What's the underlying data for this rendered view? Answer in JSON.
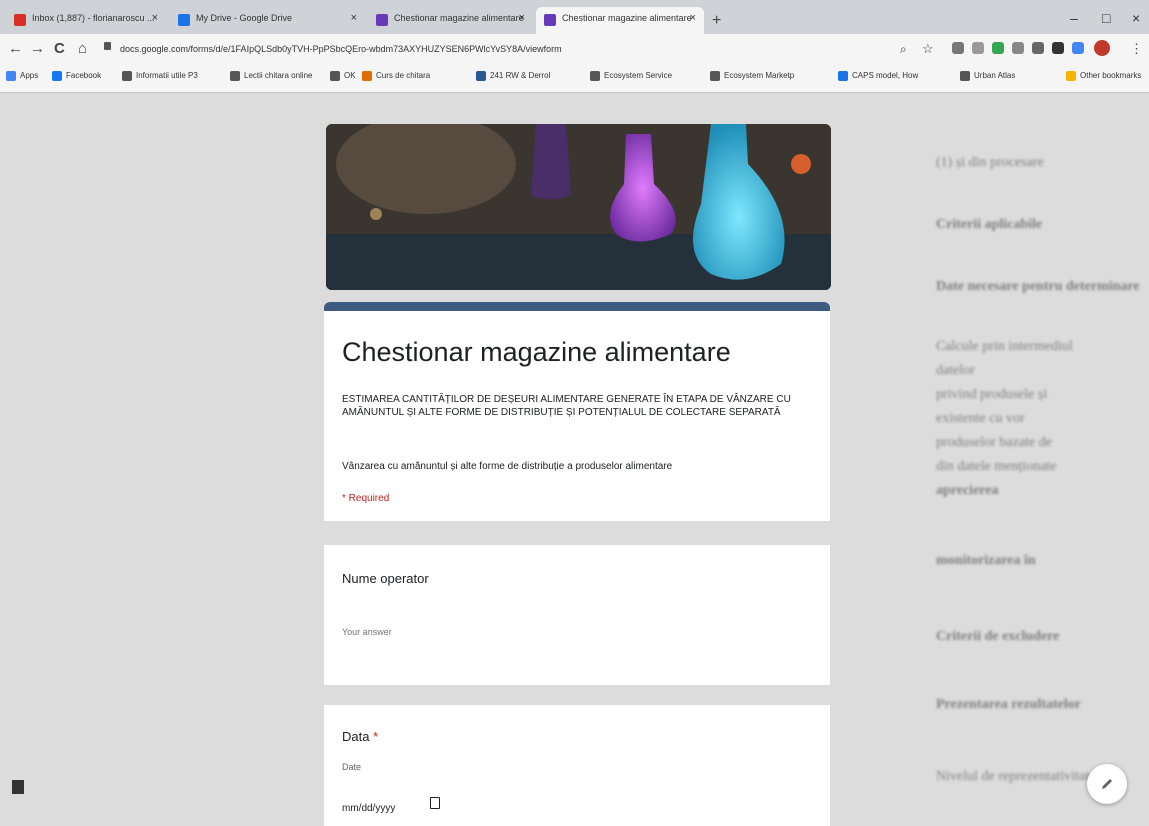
{
  "browser": {
    "tabs": [
      {
        "label": "Inbox (1,887) - florianaroscu ...",
        "color": "#d93025"
      },
      {
        "label": "My Drive - Google Drive",
        "color": "#1a73e8"
      },
      {
        "label": "Chestionar magazine alimentare",
        "color": "#673ab7"
      },
      {
        "label": "Chestionar magazine alimentare",
        "color": "#673ab7"
      }
    ],
    "url": "docs.google.com/forms/d/e/1FAIpQLSdb0yTVH-PpPSbcQEro-wbdm73AXYHUZYSEN6PWlcYvSY8A/viewform",
    "bookmarks": [
      {
        "label": "Apps",
        "color": "#4285f4"
      },
      {
        "label": "Facebook",
        "color": "#1877f2"
      },
      {
        "label": "Informatii utile P3",
        "color": "#555555"
      },
      {
        "label": "Lectii chitara online",
        "color": "#555555"
      },
      {
        "label": "OK",
        "color": "#555555"
      },
      {
        "label": "Curs de chitara",
        "color": "#e06c00"
      },
      {
        "label": "241 RW & Derrol",
        "color": "#2b5797"
      },
      {
        "label": "Ecosystem Service",
        "color": "#555555"
      },
      {
        "label": "Ecosystem Marketp",
        "color": "#555555"
      },
      {
        "label": "CAPS model, How",
        "color": "#1a73e8"
      },
      {
        "label": "Urban Atlas",
        "color": "#555555"
      },
      {
        "label": "Other bookmarks",
        "color": "#f4b400"
      }
    ]
  },
  "form": {
    "title": "Chestionar magazine alimentare",
    "description": "ESTIMAREA CANTITĂȚILOR DE DEȘEURI ALIMENTARE GENERATE ÎN ETAPA DE VÂNZARE CU AMĂNUNTUL ȘI ALTE FORME DE DISTRIBUȚIE ȘI POTENȚIALUL DE COLECTARE SEPARATĂ",
    "subdescription": "Vânzarea cu amănuntul și alte forme de distribuție a produselor alimentare",
    "required_note": "* Required",
    "questions": [
      {
        "label": "Nume operator",
        "placeholder": "Your answer"
      },
      {
        "label": "Data",
        "required_mark": "*",
        "sublabel": "Date",
        "value": "mm/dd/yyyy"
      }
    ]
  },
  "background_doc": {
    "lines": [
      "(1) și din procesare",
      "Criterii aplicabile",
      "Date necesare pentru determinare",
      "Calcule prin intermediul",
      "datelor",
      "privind produsele și",
      "existente cu vor",
      "produselor bazate de",
      "din datele menționate",
      "aprecierea",
      "monitorizarea în",
      "Criterii de excludere",
      "Prezentarea rezultatelor",
      "Nivelul de reprezentativitate"
    ]
  },
  "colors": {
    "accent": "#3d5a80",
    "required": "#c5221f"
  },
  "icons": [
    "back-icon",
    "forward-icon",
    "reload-icon",
    "home-icon",
    "lock-icon",
    "star-icon",
    "calendar-icon",
    "edit-icon"
  ]
}
